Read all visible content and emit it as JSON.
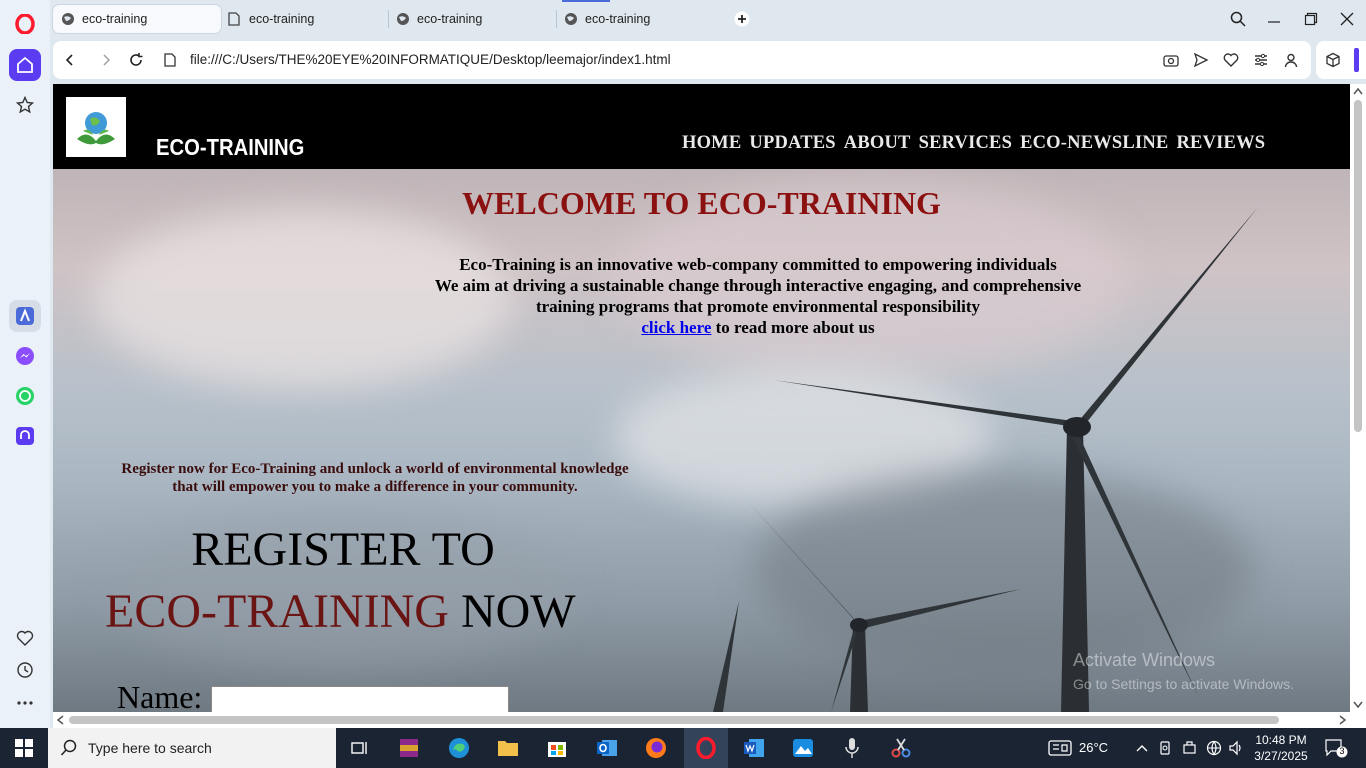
{
  "tabs": [
    {
      "title": "eco-training"
    },
    {
      "title": "eco-training"
    },
    {
      "title": "eco-training"
    },
    {
      "title": "eco-training"
    }
  ],
  "address": {
    "url": "file:///C:/Users/THE%20EYE%20INFORMATIQUE/Desktop/leemajor/index1.html"
  },
  "site": {
    "brand": "ECO-TRAINING",
    "nav": [
      "HOME",
      "UPDATES",
      "ABOUT",
      "SERVICES",
      "ECO-NEWSLINE",
      "REVIEWS"
    ],
    "welcome": "WELCOME TO ECO-TRAINING",
    "intro_lines": [
      "Eco-Training is an innovative web-company committed to empowering individuals",
      "We aim at driving a sustainable change through interactive engaging, and comprehensive",
      "training programs that promote environmental responsibility"
    ],
    "link_text": "click here",
    "link_suffix": " to read more about us",
    "register_lines": [
      "Register now for Eco-Training and unlock a world of environmental knowledge",
      "that will empower you to make a difference in your community."
    ],
    "register_h1": "REGISTER TO",
    "register_h2_red": "ECO-TRAINING",
    "register_h2_black": " NOW",
    "name_label": "Name:",
    "name_value": ""
  },
  "watermark": {
    "line1": "Activate Windows",
    "line2": "Go to Settings to activate Windows."
  },
  "taskbar": {
    "search_placeholder": "Type here to search",
    "temperature": "26°C",
    "time": "10:48 PM",
    "date": "3/27/2025",
    "notification_count": "3"
  },
  "colors": {
    "accent": "#8b1010",
    "browser_red": "#ff1b2d",
    "sidebar_active": "#5b3cf0"
  }
}
